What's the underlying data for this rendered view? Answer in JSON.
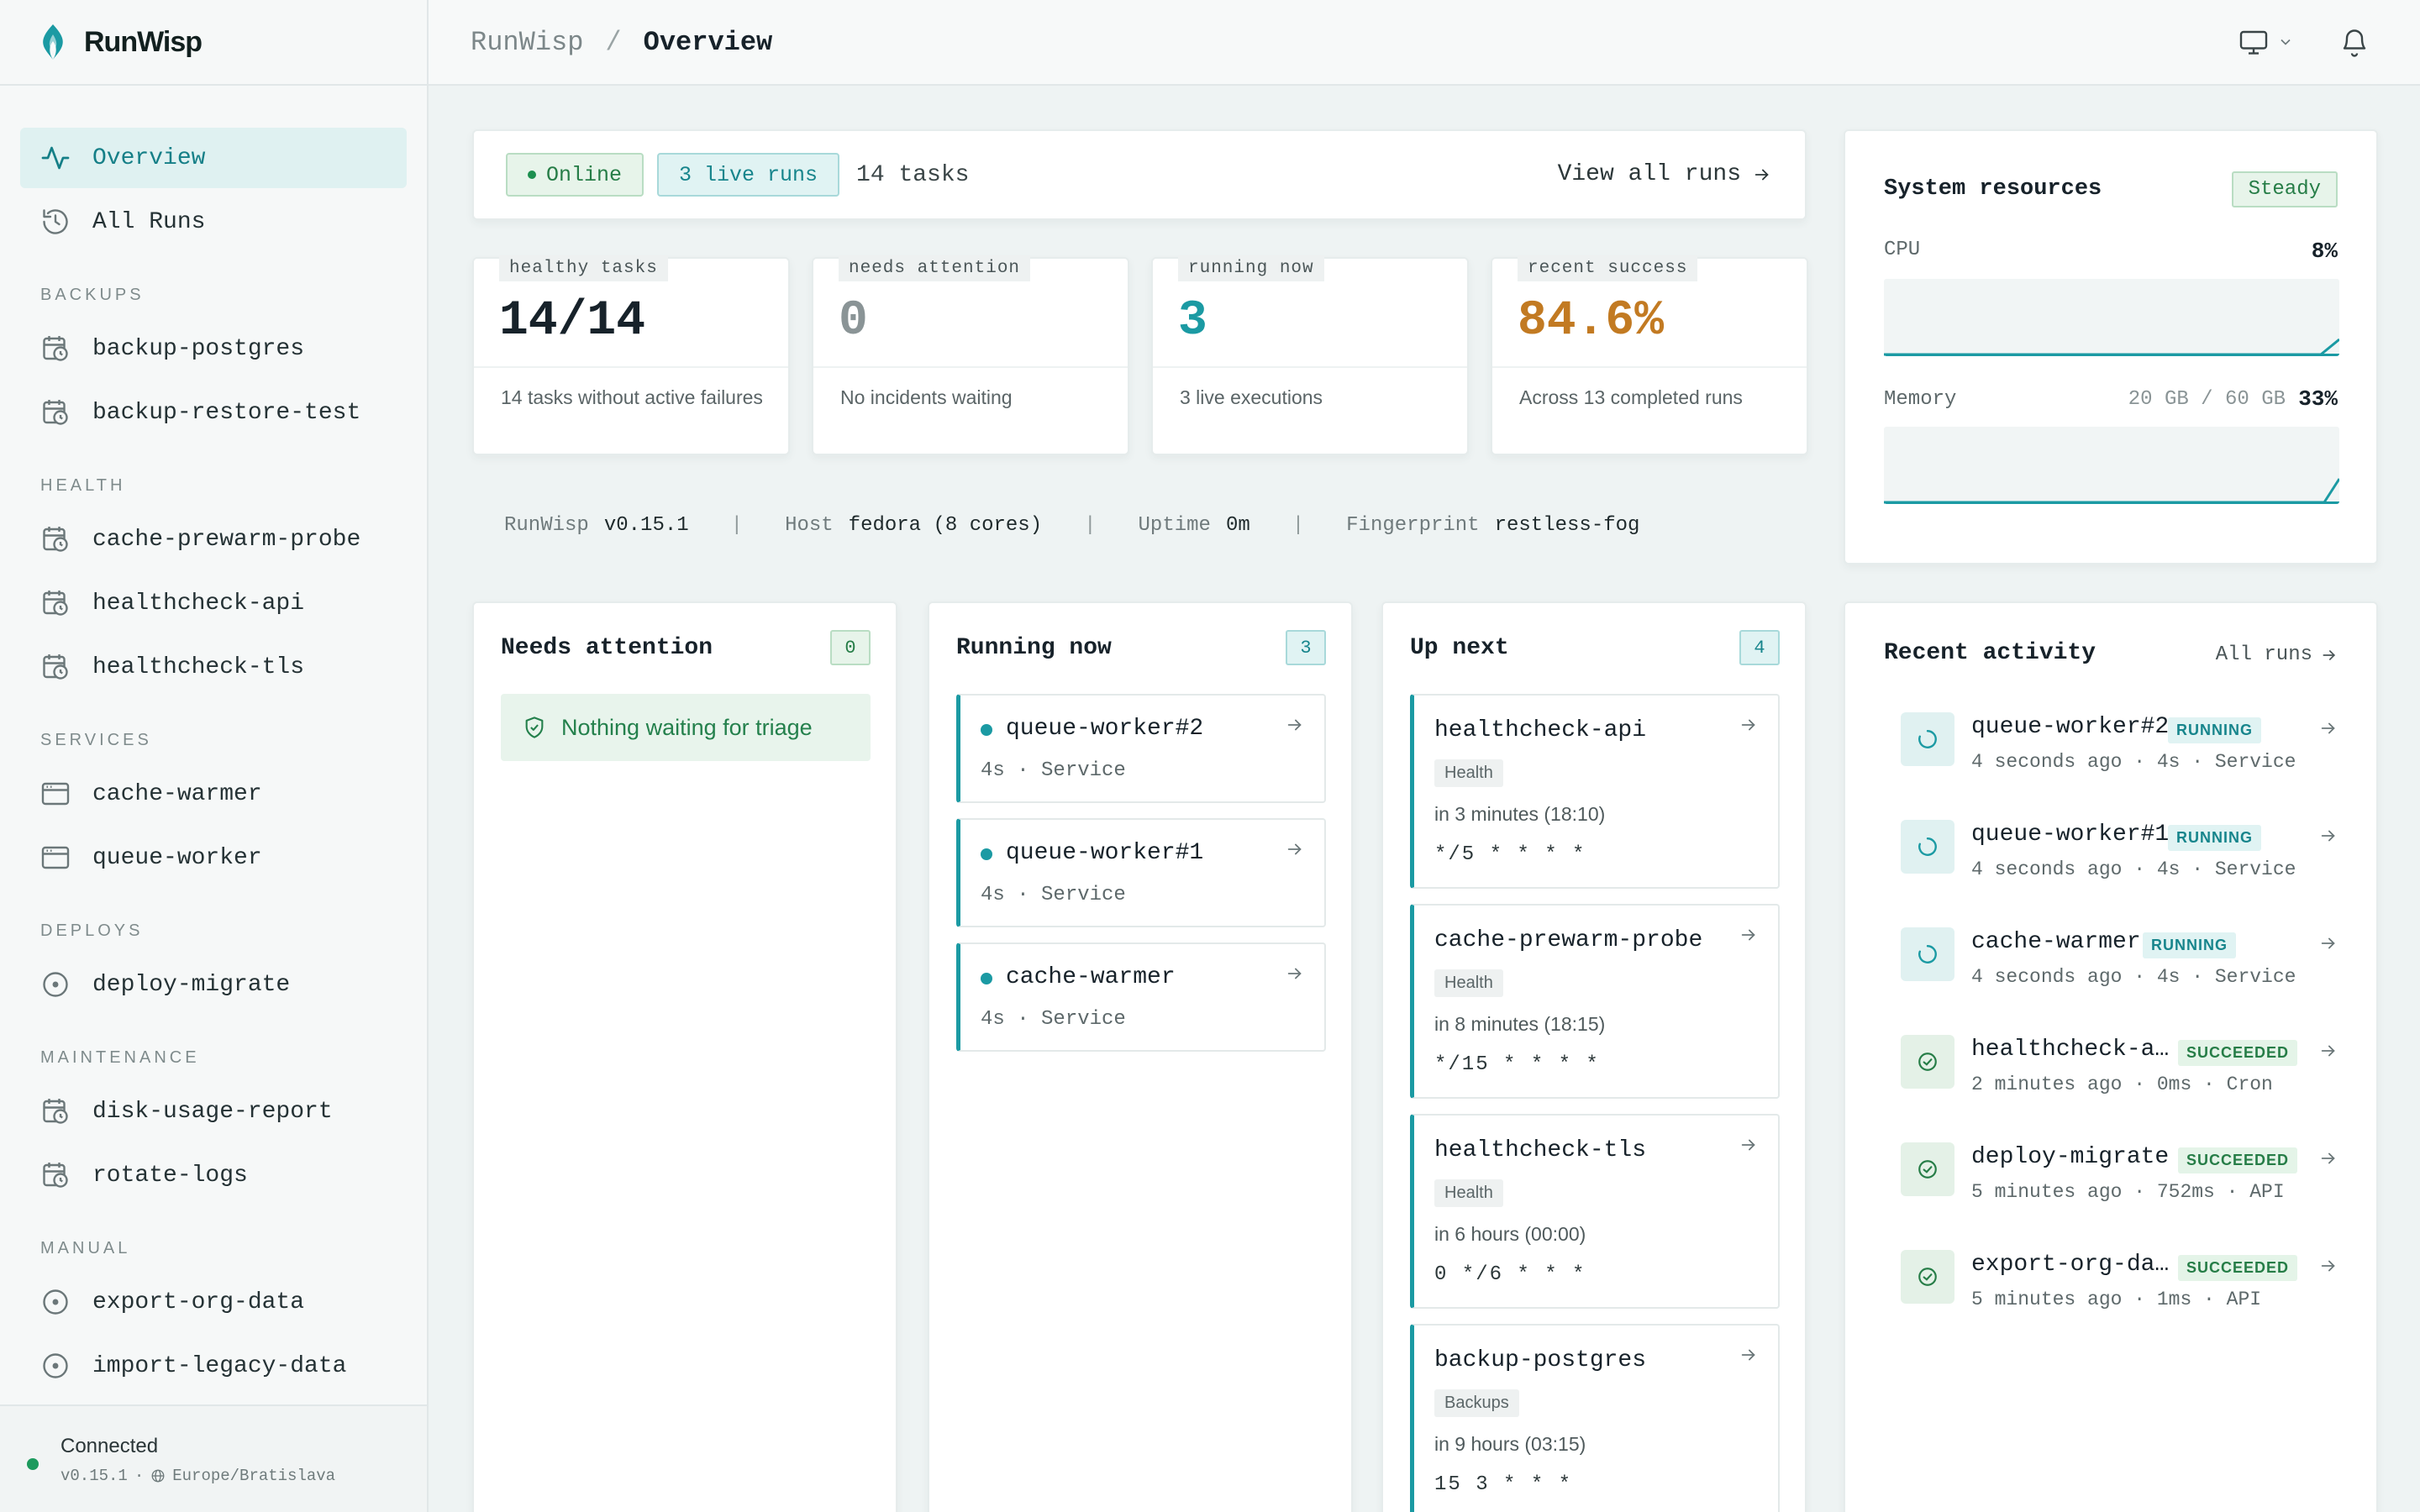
{
  "brand": {
    "name": "RunWisp",
    "accent": "#1b9aa3"
  },
  "sidebar": {
    "primary": [
      {
        "label": "Overview",
        "icon": "activity-icon",
        "active": true
      },
      {
        "label": "All Runs",
        "icon": "history-icon",
        "active": false
      }
    ],
    "sections": [
      {
        "title": "BACKUPS",
        "items": [
          {
            "label": "backup-postgres",
            "icon": "calendar-clock-icon"
          },
          {
            "label": "backup-restore-test",
            "icon": "calendar-clock-icon"
          }
        ]
      },
      {
        "title": "HEALTH",
        "items": [
          {
            "label": "cache-prewarm-probe",
            "icon": "calendar-clock-icon"
          },
          {
            "label": "healthcheck-api",
            "icon": "calendar-clock-icon"
          },
          {
            "label": "healthcheck-tls",
            "icon": "calendar-clock-icon"
          }
        ]
      },
      {
        "title": "SERVICES",
        "items": [
          {
            "label": "cache-warmer",
            "icon": "window-icon"
          },
          {
            "label": "queue-worker",
            "icon": "window-icon"
          }
        ]
      },
      {
        "title": "DEPLOYS",
        "items": [
          {
            "label": "deploy-migrate",
            "icon": "circle-dot-icon"
          }
        ]
      },
      {
        "title": "MAINTENANCE",
        "items": [
          {
            "label": "disk-usage-report",
            "icon": "calendar-clock-icon"
          },
          {
            "label": "rotate-logs",
            "icon": "calendar-clock-icon"
          }
        ]
      },
      {
        "title": "MANUAL",
        "items": [
          {
            "label": "export-org-data",
            "icon": "circle-dot-icon"
          },
          {
            "label": "import-legacy-data",
            "icon": "circle-dot-icon"
          }
        ]
      }
    ],
    "footer": {
      "status": "Connected",
      "version": "v0.15.1",
      "timezone": "Europe/Bratislava"
    }
  },
  "topbar": {
    "crumb_root": "RunWisp",
    "crumb_sep": "/",
    "crumb_current": "Overview"
  },
  "status_bar": {
    "online": "Online",
    "live_runs": "3 live runs",
    "tasks": "14 tasks",
    "view_all": "View all runs"
  },
  "stats": [
    {
      "label": "healthy tasks",
      "value": "14/14",
      "desc": "14 tasks without active failures",
      "color": "#17222a"
    },
    {
      "label": "needs attention",
      "value": "0",
      "desc": "No incidents waiting",
      "color": "#8a9496"
    },
    {
      "label": "running now",
      "value": "3",
      "desc": "3 live executions",
      "color": "#1b9aa3"
    },
    {
      "label": "recent success",
      "value": "84.6%",
      "desc": "Across 13 completed runs",
      "color": "#c27a22"
    }
  ],
  "info": {
    "app_label": "RunWisp",
    "app_value": "v0.15.1",
    "host_label": "Host",
    "host_value": "fedora (8 cores)",
    "uptime_label": "Uptime",
    "uptime_value": "0m",
    "fp_label": "Fingerprint",
    "fp_value": "restless-fog"
  },
  "resources": {
    "title": "System resources",
    "badge": "Steady",
    "cpu_label": "CPU",
    "cpu_value": "8%",
    "mem_label": "Memory",
    "mem_extra": "20 GB / 60 GB",
    "mem_value": "33%"
  },
  "needs_attention": {
    "title": "Needs attention",
    "count": "0",
    "empty": "Nothing waiting for triage"
  },
  "running_now": {
    "title": "Running now",
    "count": "3",
    "items": [
      {
        "name": "queue-worker#2",
        "meta": "4s · Service"
      },
      {
        "name": "queue-worker#1",
        "meta": "4s · Service"
      },
      {
        "name": "cache-warmer",
        "meta": "4s · Service"
      }
    ]
  },
  "up_next": {
    "title": "Up next",
    "count": "4",
    "items": [
      {
        "name": "healthcheck-api",
        "tag": "Health",
        "when": "in 3 minutes (18:10)",
        "cron": "*/5 * * * *"
      },
      {
        "name": "cache-prewarm-probe",
        "tag": "Health",
        "when": "in 8 minutes (18:15)",
        "cron": "*/15 * * * *"
      },
      {
        "name": "healthcheck-tls",
        "tag": "Health",
        "when": "in 6 hours (00:00)",
        "cron": "0 */6 * * *"
      },
      {
        "name": "backup-postgres",
        "tag": "Backups",
        "when": "in 9 hours (03:15)",
        "cron": "15 3 * * *"
      }
    ]
  },
  "activity": {
    "title": "Recent activity",
    "all_runs": "All runs",
    "items": [
      {
        "name": "queue-worker#2",
        "status": "RUNNING",
        "meta": "4 seconds ago · 4s · Service",
        "kind": "running"
      },
      {
        "name": "queue-worker#1",
        "status": "RUNNING",
        "meta": "4 seconds ago · 4s · Service",
        "kind": "running"
      },
      {
        "name": "cache-warmer",
        "status": "RUNNING",
        "meta": "4 seconds ago · 4s · Service",
        "kind": "running"
      },
      {
        "name": "healthcheck-a…",
        "status": "SUCCEEDED",
        "meta": "2 minutes ago · 0ms · Cron",
        "kind": "succeeded"
      },
      {
        "name": "deploy-migrate",
        "status": "SUCCEEDED",
        "meta": "5 minutes ago · 752ms · API",
        "kind": "succeeded"
      },
      {
        "name": "export-org-da…",
        "status": "SUCCEEDED",
        "meta": "5 minutes ago · 1ms · API",
        "kind": "succeeded"
      }
    ]
  }
}
